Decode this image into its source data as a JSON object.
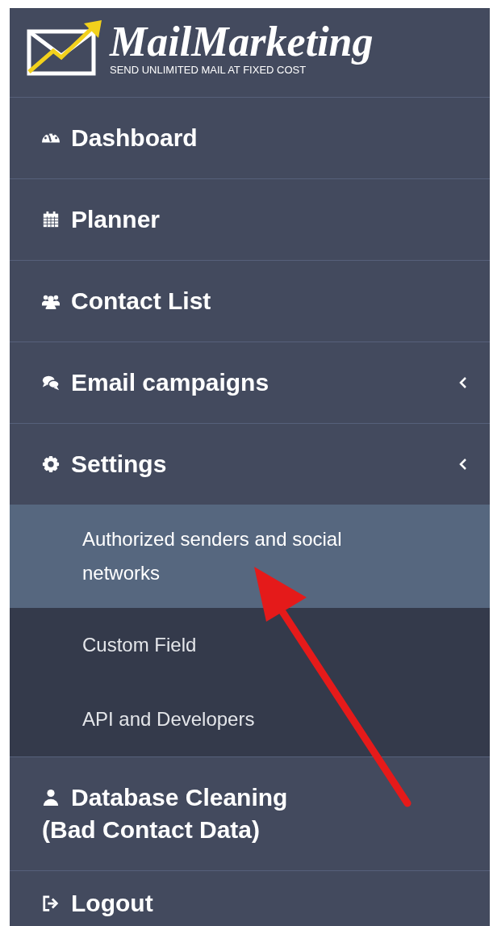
{
  "logo": {
    "title": "MailMarketing",
    "tagline": "SEND UNLIMITED MAIL AT FIXED COST"
  },
  "menu": [
    {
      "label": "Dashboard",
      "chevron": false
    },
    {
      "label": "Planner",
      "chevron": false
    },
    {
      "label": "Contact List",
      "chevron": false
    },
    {
      "label": "Email campaigns",
      "chevron": true
    },
    {
      "label": "Settings",
      "chevron": true,
      "children": [
        {
          "label": "Authorized senders and social networks",
          "selected": true
        },
        {
          "label": "Custom Field",
          "selected": false
        },
        {
          "label": "API and Developers",
          "selected": false
        }
      ]
    },
    {
      "label": "Database Cleaning (Bad Contact Data)",
      "chevron": false
    },
    {
      "label": "Logout",
      "chevron": false
    }
  ]
}
